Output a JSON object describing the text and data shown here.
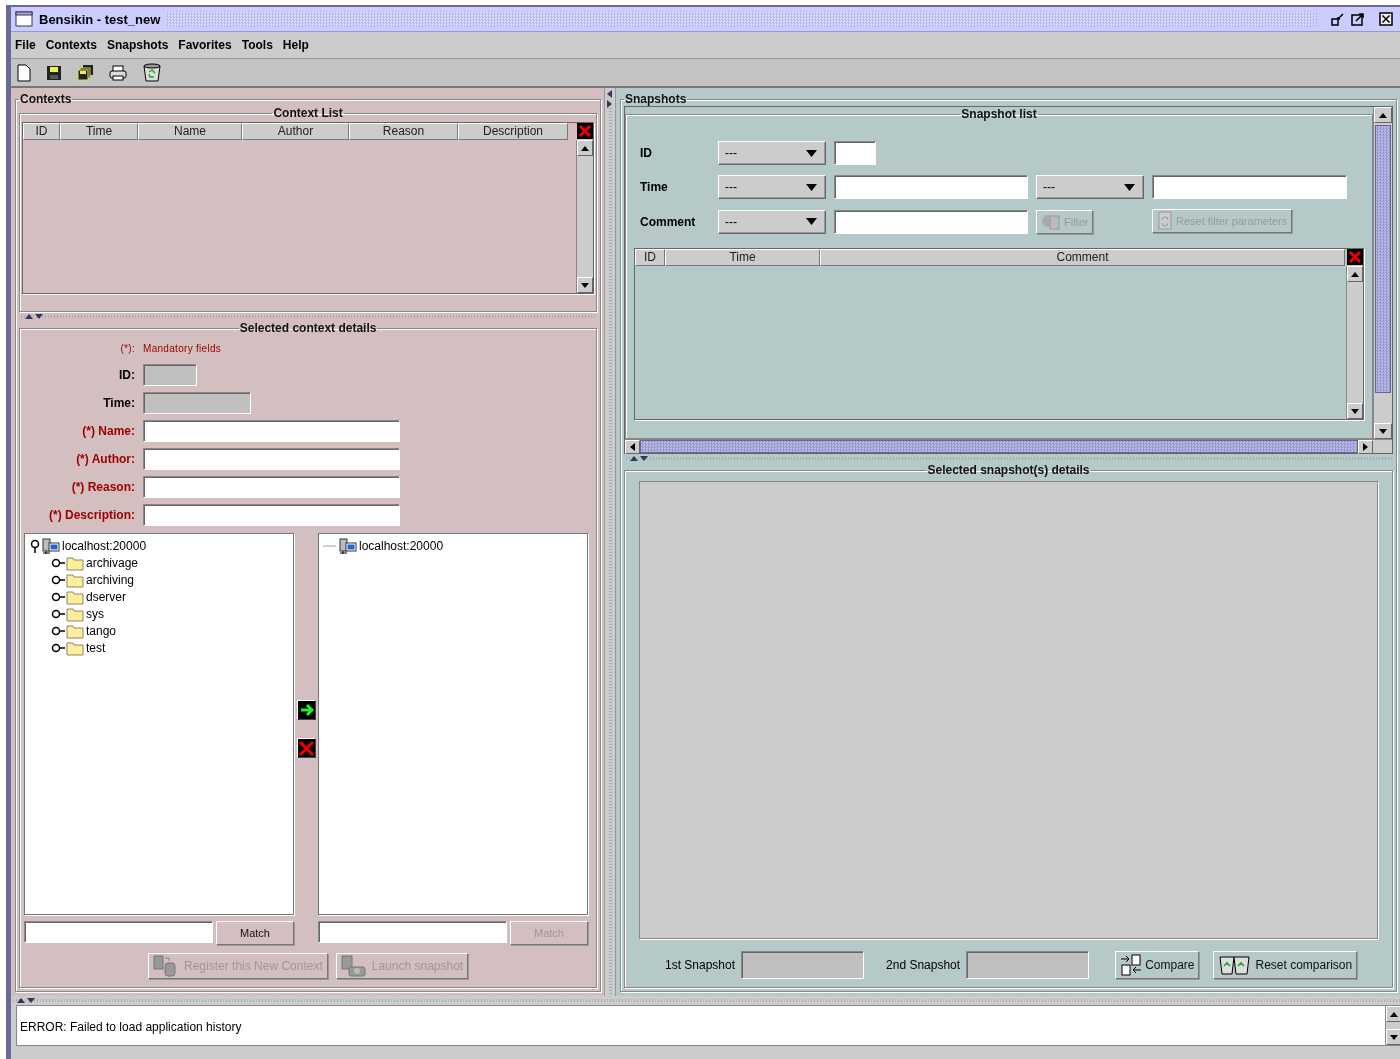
{
  "window": {
    "title": "Bensikin - test_new"
  },
  "menu": [
    {
      "label": "File"
    },
    {
      "label": "Contexts"
    },
    {
      "label": "Snapshots"
    },
    {
      "label": "Favorites"
    },
    {
      "label": "Tools"
    },
    {
      "label": "Help"
    }
  ],
  "contexts": {
    "title": "Contexts",
    "context_list": {
      "title": "Context List",
      "columns": [
        "ID",
        "Time",
        "Name",
        "Author",
        "Reason",
        "Description"
      ]
    },
    "details": {
      "title": "Selected context details",
      "note_mark": "(*):",
      "note": "Mandatory fields",
      "fields": [
        {
          "label": "ID:",
          "required": false,
          "disabled": true
        },
        {
          "label": "Time:",
          "required": false,
          "disabled": true
        },
        {
          "label": "(*) Name:",
          "required": true,
          "disabled": false
        },
        {
          "label": "(*) Author:",
          "required": true,
          "disabled": false
        },
        {
          "label": "(*) Reason:",
          "required": true,
          "disabled": false
        },
        {
          "label": "(*) Description:",
          "required": true,
          "disabled": false
        }
      ]
    },
    "trees": [
      {
        "root": "localhost:20000",
        "expanded": true,
        "children": [
          {
            "label": "archivage",
            "expanded": false
          },
          {
            "label": "archiving",
            "expanded": false
          },
          {
            "label": "dserver",
            "expanded": false
          },
          {
            "label": "sys",
            "expanded": false
          },
          {
            "label": "tango",
            "expanded": false
          },
          {
            "label": "test",
            "expanded": false
          }
        ],
        "match": {
          "label": "Match",
          "disabled": false
        }
      },
      {
        "root": "localhost:20000",
        "expanded": false,
        "match": {
          "label": "Match",
          "disabled": true
        }
      }
    ],
    "actions": [
      {
        "label": "Register this New Context",
        "disabled": true
      },
      {
        "label": "Launch snapshot",
        "disabled": true
      }
    ]
  },
  "snapshots": {
    "title": "Snapshots",
    "snapshot_list": {
      "title": "Snapshot list",
      "filters": [
        {
          "label": "ID",
          "controls": [
            {
              "kind": "select",
              "value": "---"
            },
            {
              "kind": "short-field"
            }
          ]
        },
        {
          "label": "Time",
          "controls": [
            {
              "kind": "select",
              "value": "---"
            },
            {
              "kind": "field"
            },
            {
              "kind": "select",
              "value": "---"
            },
            {
              "kind": "field"
            }
          ]
        },
        {
          "label": "Comment",
          "controls": [
            {
              "kind": "select",
              "value": "---"
            },
            {
              "kind": "field"
            },
            {
              "kind": "button",
              "label": "Filter",
              "disabled": true
            },
            {
              "kind": "button",
              "label": "Reset filter parameters",
              "disabled": true
            }
          ]
        }
      ],
      "columns": [
        "ID",
        "Time",
        "Comment"
      ]
    },
    "details": {
      "title": "Selected snapshot(s) details",
      "compare": [
        {
          "label": "1st Snapshot"
        },
        {
          "label": "2nd Snapshot"
        }
      ],
      "buttons": [
        {
          "label": "Compare",
          "disabled": false
        },
        {
          "label": "Reset comparison",
          "disabled": false
        }
      ]
    }
  },
  "log": {
    "lines": [
      "ERROR: Failed to load application history"
    ]
  }
}
